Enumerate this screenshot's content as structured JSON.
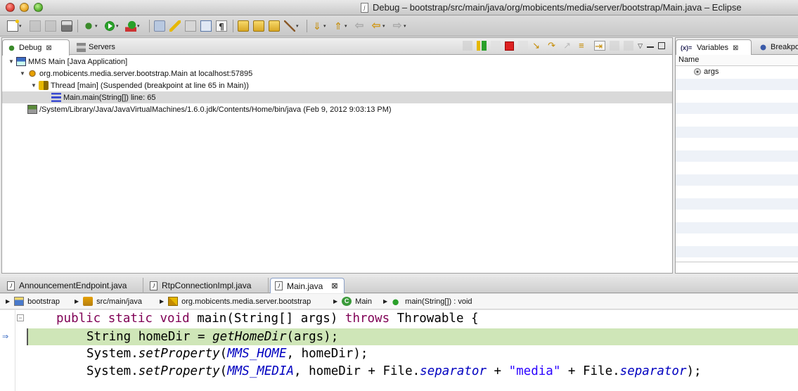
{
  "window": {
    "title": "Debug – bootstrap/src/main/java/org/mobicents/media/server/bootstrap/Main.java – Eclipse",
    "doc_icon": "j"
  },
  "toolbar": {
    "icons": [
      "new-wizard-icon",
      "save-icon",
      "print-icon",
      "debug-icon",
      "run-icon",
      "external-tools-icon",
      "skip-breakpoints-icon",
      "mark-occurrences-icon",
      "toggle-block-icon",
      "show-whitespace-icon",
      "open-type-icon",
      "open-task-icon",
      "open-resource-icon",
      "search-icon",
      "next-annotation-icon",
      "previous-annotation-icon",
      "back-icon",
      "forward-icon"
    ]
  },
  "debug_view": {
    "tabs": [
      {
        "label": "Debug",
        "active": true,
        "close": "⊠"
      },
      {
        "label": "Servers",
        "active": false
      }
    ],
    "tree": [
      {
        "label": "MMS Main [Java Application]",
        "level": 0,
        "expanded": true
      },
      {
        "label": "org.mobicents.media.server.bootstrap.Main at localhost:57895",
        "level": 1,
        "expanded": true
      },
      {
        "label": "Thread [main] (Suspended (breakpoint at line 65 in Main))",
        "level": 2,
        "expanded": true
      },
      {
        "label": "Main.main(String[]) line: 65",
        "level": 3,
        "selected": true
      },
      {
        "label": "/System/Library/Java/JavaVirtualMachines/1.6.0.jdk/Contents/Home/bin/java (Feb 9, 2012 9:03:13 PM)",
        "level": 1
      }
    ]
  },
  "variables_view": {
    "tabs": [
      {
        "label": "Variables",
        "active": true,
        "close": "⊠"
      },
      {
        "label": "Breakpoints",
        "active": false
      }
    ],
    "column": "Name",
    "rows": [
      {
        "name": "args"
      }
    ]
  },
  "editor": {
    "tabs": [
      {
        "label": "AnnouncementEndpoint.java",
        "active": false
      },
      {
        "label": "RtpConnectionImpl.java",
        "active": false
      },
      {
        "label": "Main.java",
        "active": true,
        "close": "⊠"
      }
    ],
    "breadcrumb": [
      "bootstrap",
      "src/main/java",
      "org.mobicents.media.server.bootstrap",
      "Main",
      "main(String[]) : void"
    ],
    "code": {
      "line1": {
        "kw1": "public static void ",
        "plain1": "main(String[] args) ",
        "kw2": "throws",
        "plain2": " Throwable {"
      },
      "line2": {
        "plain1": "String homeDir = ",
        "call": "getHomeDir",
        "plain2": "(args);"
      },
      "line3": {
        "plain1": "System.",
        "call": "setProperty",
        "plain2": "(",
        "field": "MMS_HOME",
        "plain3": ", homeDir);"
      },
      "line4": {
        "plain1": "System.",
        "call": "setProperty",
        "plain2": "(",
        "field": "MMS_MEDIA",
        "plain3": ", homeDir + File.",
        "field2": "separator",
        "plain4": " + ",
        "str": "\"media\"",
        "plain5": " + File.",
        "field3": "separator",
        "plain6": ");"
      }
    }
  },
  "colors": {
    "current_line": "#cfe6b8",
    "keyword": "#7f0055",
    "field": "#0000c0",
    "string": "#2a00ff"
  }
}
